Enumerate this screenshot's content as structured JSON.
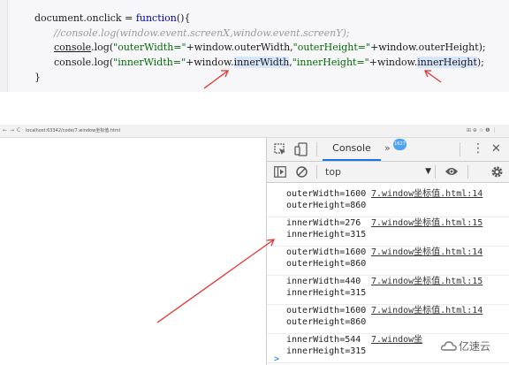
{
  "editor": {
    "line1": {
      "obj": "document",
      "dot": ".",
      "prop": "onclick",
      "eq": " = ",
      "kw": "function",
      "tail": "(){"
    },
    "line2": "//console.log(window.event.screenX,window.event.screenY);",
    "line3": {
      "obj": "console",
      "call": ".log(",
      "str1": "\"outerWidth=\"",
      "mid1": "+window.outerWidth,",
      "str2": "\"outerHeight=\"",
      "mid2": "+window.outerHeight);"
    },
    "line4": {
      "obj": "console",
      "call": ".log(",
      "str1": "\"innerWidth=\"",
      "mid1a": "+window.",
      "mid1b": "innerWidth",
      "comma": ",",
      "str2": "\"innerHeight=\"",
      "mid2a": "+window.",
      "mid2b": "innerHeight",
      "end": ");"
    },
    "line5": "}"
  },
  "browser": {
    "nav_back": "←",
    "nav_forward": "→",
    "nav_reload": "C",
    "address": "localhost:63342/code/7.window坐标值.html",
    "right_icons": "⊞  ⊕  ☆  ❶  ⋮"
  },
  "devtools": {
    "inspect_icon": "inspect-element-icon",
    "device_icon": "device-toolbar-icon",
    "console_tab": "Console",
    "more_tabs": "»",
    "badge": "1627",
    "menu": "⋮",
    "close": "✕",
    "context": "top",
    "context_arrow": "▼",
    "prompt": ">"
  },
  "console_logs": [
    {
      "line1": "outerWidth=1600",
      "line2": "outerHeight=860",
      "source": "7.window坐标值.html:14"
    },
    {
      "line1": "innerWidth=276",
      "line2": "innerHeight=315",
      "source": "7.window坐标值.html:15"
    },
    {
      "line1": "outerWidth=1600",
      "line2": "outerHeight=860",
      "source": "7.window坐标值.html:14"
    },
    {
      "line1": "innerWidth=440",
      "line2": "innerHeight=315",
      "source": "7.window坐标值.html:15"
    },
    {
      "line1": "outerWidth=1600",
      "line2": "outerHeight=860",
      "source": "7.window坐标值.html:14"
    },
    {
      "line1": "innerWidth=544",
      "line2": "innerHeight=315",
      "source": "7.window坐"
    }
  ],
  "watermark": {
    "text": "亿速云"
  },
  "colors": {
    "arrow": "#e5322d",
    "accent": "#1a73e8",
    "keyword": "#0000a8",
    "string": "#036a07"
  }
}
